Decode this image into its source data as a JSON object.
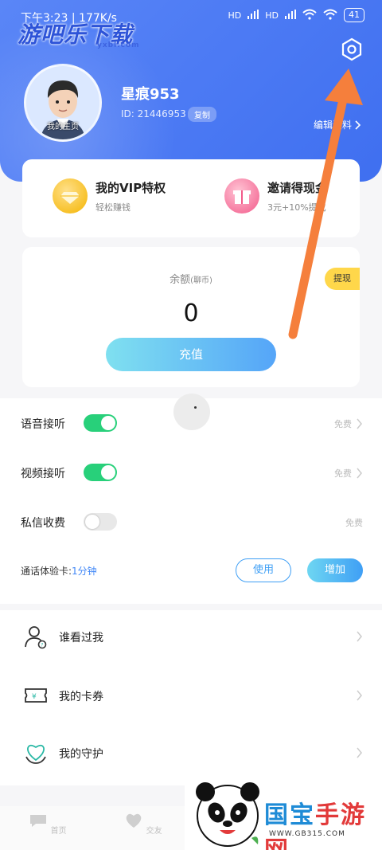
{
  "status_bar": {
    "time_text": "下午3:23 | 177K/s",
    "network_1": "HD",
    "network_2": "HD",
    "battery": "41"
  },
  "watermark_top": {
    "text": "游吧乐下载",
    "sub": "yxbl.com"
  },
  "profile": {
    "avatar_label": "我的主页",
    "username": "星痕953",
    "id_text": "ID: 21446953",
    "copy_label": "复制",
    "edit_label": "编辑资料"
  },
  "vip": {
    "vip_title": "我的VIP特权",
    "vip_sub": "轻松赚钱",
    "invite_title": "邀请得现金",
    "invite_sub": "3元+10%提成"
  },
  "balance": {
    "label": "余额",
    "unit": "(聊币)",
    "value": "0",
    "withdraw_label": "提现",
    "recharge_label": "充值"
  },
  "settings": [
    {
      "label": "语音接听",
      "on": true,
      "right": "免费"
    },
    {
      "label": "视频接听",
      "on": true,
      "right": "免费"
    },
    {
      "label": "私信收费",
      "on": false,
      "right": "免费"
    }
  ],
  "trial": {
    "label_prefix": "通话体验卡:",
    "label_value": "1分钟",
    "use_label": "使用",
    "add_label": "增加"
  },
  "menu": [
    {
      "label": "谁看过我",
      "icon": "visitor-icon"
    },
    {
      "label": "我的卡券",
      "icon": "coupon-icon"
    },
    {
      "label": "我的守护",
      "icon": "guard-heart-icon"
    }
  ],
  "tabbar": [
    {
      "label": "首页",
      "icon": "home-chat-icon"
    },
    {
      "label": "交友",
      "icon": "heart-icon"
    }
  ],
  "watermark_bottom": {
    "title_part1": "国宝",
    "title_part2": "手游网",
    "url": "WWW.GB315.COM"
  },
  "colors": {
    "header_blue": "#4d7bf4",
    "toggle_green": "#28d07a",
    "accent_blue": "#3f9ff5",
    "withdraw_yellow": "#ffd74a",
    "arrow_orange": "#f57f3c"
  }
}
